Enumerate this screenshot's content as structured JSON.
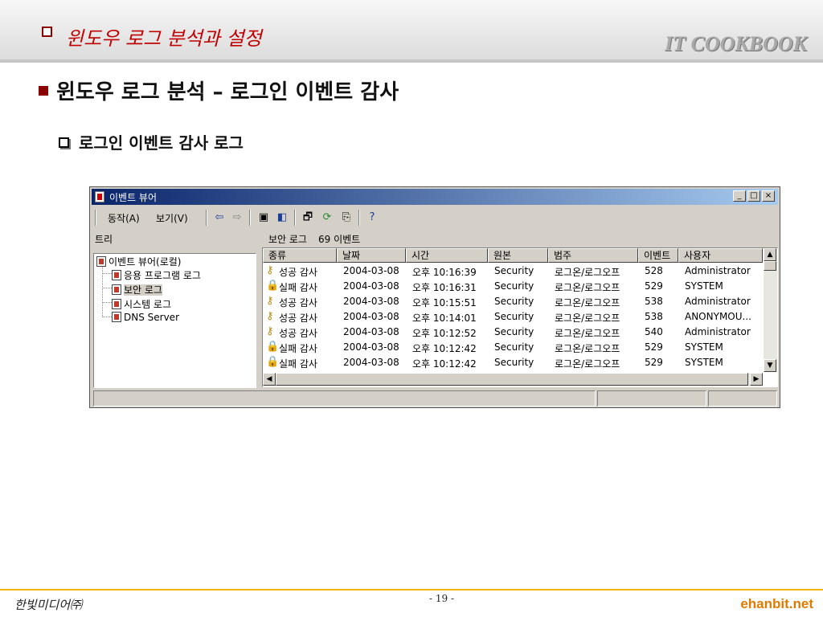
{
  "slide": {
    "header_title": "윈도우 로그 분석과 설정",
    "brand": "IT COOKBOOK",
    "heading": "윈도우 로그 분석 – 로그인 이벤트 감사",
    "subheading": "로그인 이벤트 감사 로그",
    "footer_left": "한빛미디어㈜",
    "footer_page": "- 19 -",
    "footer_right": "ehanbit.net",
    "colors": {
      "accent_red": "#c00000",
      "footer_orange": "#e07b00",
      "titlebar": "#0a246a"
    }
  },
  "window": {
    "title": "이벤트 뷰어",
    "title_buttons": [
      "_",
      "□",
      "×"
    ],
    "menu": [
      "동작(A)",
      "보기(V)"
    ],
    "toolbar_icons": [
      "back-arrow-icon",
      "forward-arrow-icon",
      "up-folder-icon",
      "show-hide-tree-icon",
      "properties-icon",
      "refresh-icon",
      "export-list-icon",
      "help-icon"
    ],
    "tree_label": "트리",
    "log_label": "보안 로그",
    "log_count": "69 이벤트",
    "tree": {
      "root": "이벤트 뷰어(로컬)",
      "items": [
        "응용 프로그램 로그",
        "보안 로그",
        "시스템 로그",
        "DNS Server"
      ],
      "selected_index": 1
    },
    "columns": [
      "종류",
      "날짜",
      "시간",
      "원본",
      "범주",
      "이벤트",
      "사용자"
    ],
    "rows": [
      {
        "type": "성공 감사",
        "icon": "key",
        "date": "2004-03-08",
        "time": "오후 10:16:39",
        "source": "Security",
        "category": "로그온/로그오프",
        "event": "528",
        "user": "Administrator"
      },
      {
        "type": "실패 감사",
        "icon": "lock",
        "date": "2004-03-08",
        "time": "오후 10:16:31",
        "source": "Security",
        "category": "로그온/로그오프",
        "event": "529",
        "user": "SYSTEM"
      },
      {
        "type": "성공 감사",
        "icon": "key",
        "date": "2004-03-08",
        "time": "오후 10:15:51",
        "source": "Security",
        "category": "로그온/로그오프",
        "event": "538",
        "user": "Administrator"
      },
      {
        "type": "성공 감사",
        "icon": "key",
        "date": "2004-03-08",
        "time": "오후 10:14:01",
        "source": "Security",
        "category": "로그온/로그오프",
        "event": "538",
        "user": "ANONYMOU..."
      },
      {
        "type": "성공 감사",
        "icon": "key",
        "date": "2004-03-08",
        "time": "오후 10:12:52",
        "source": "Security",
        "category": "로그온/로그오프",
        "event": "540",
        "user": "Administrator"
      },
      {
        "type": "실패 감사",
        "icon": "lock",
        "date": "2004-03-08",
        "time": "오후 10:12:42",
        "source": "Security",
        "category": "로그온/로그오프",
        "event": "529",
        "user": "SYSTEM"
      },
      {
        "type": "실패 감사",
        "icon": "lock",
        "date": "2004-03-08",
        "time": "오후 10:12:42",
        "source": "Security",
        "category": "로그온/로그오프",
        "event": "529",
        "user": "SYSTEM"
      }
    ]
  }
}
